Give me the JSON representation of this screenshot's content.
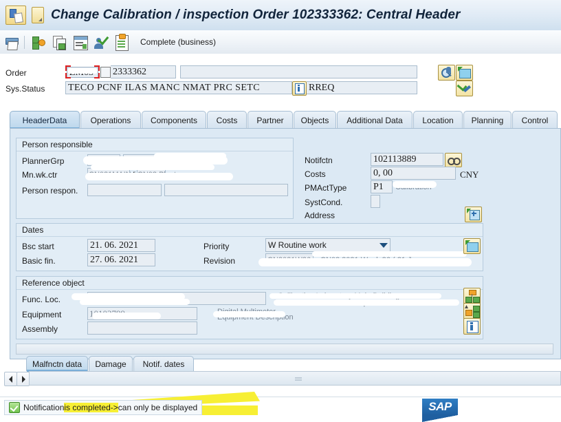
{
  "window": {
    "title": "Change Calibration / inspection Order 102333362: Central Header",
    "sys_icon": "sap-system-icon",
    "menu_icon": "menu-dropdown-icon"
  },
  "toolbar": {
    "buttons": [
      {
        "name": "print-icon",
        "label": ""
      },
      {
        "name": "network-graphic-icon",
        "label": ""
      },
      {
        "name": "copy-icon",
        "label": ""
      },
      {
        "name": "list-display-icon",
        "label": ""
      },
      {
        "name": "check-person-icon",
        "label": ""
      },
      {
        "name": "clipboard-icon",
        "label": ""
      }
    ],
    "complete_label": "Complete (business)"
  },
  "order_header": {
    "order_label": "Order",
    "order_type": "ZM03",
    "order_number": "2333362",
    "order_description": "",
    "sys_status_label": "Sys.Status",
    "status_codes": "TECO PCNF ILAS MANC NMAT PRC  SETC",
    "status_extra": "RREQ",
    "info_icon": "info-icon",
    "search_icon": "search-order-icon",
    "display_icon": "display-object-icon",
    "edit_icon": "check-edit-icon"
  },
  "tabs": [
    {
      "label": "HeaderData",
      "active": true
    },
    {
      "label": "Operations",
      "active": false
    },
    {
      "label": "Components",
      "active": false
    },
    {
      "label": "Costs",
      "active": false
    },
    {
      "label": "Partner",
      "active": false
    },
    {
      "label": "Objects",
      "active": false
    },
    {
      "label": "Additional Data",
      "active": false
    },
    {
      "label": "Location",
      "active": false
    },
    {
      "label": "Planning",
      "active": false
    },
    {
      "label": "Control",
      "active": false
    }
  ],
  "person_responsible": {
    "title": "Person responsible",
    "planner_grp_label": "PlannerGrp",
    "planner_grp_value": "",
    "mn_wk_ctr_label": "Mn.wk.ctr",
    "mn_wk_ctr_value": "",
    "person_respon_label": "Person respon.",
    "person_respon_value": "",
    "person_respon_value2": ""
  },
  "notification_block": {
    "notifctn_label": "Notifctn",
    "notifctn_value": "102113889",
    "notifctn_icon": "link-notification-icon",
    "costs_label": "Costs",
    "costs_value": "0, 00",
    "costs_currency": "CNY",
    "pmacttype_label": "PMActType",
    "pmacttype_value": "P1",
    "pmacttype_text": "",
    "systcond_label": "SystCond.",
    "systcond_value": "",
    "address_label": "Address",
    "address_icon": "address-detail-icon"
  },
  "dates": {
    "title": "Dates",
    "bsc_start_label": "Bsc start",
    "bsc_start_value": "21. 06. 2021",
    "basic_fin_label": "Basic fin.",
    "basic_fin_value": "27. 06. 2021",
    "priority_label": "Priority",
    "priority_value": "W Routine work",
    "priority_dropdown_icon": "chevron-down-icon",
    "revision_label": "Revision",
    "revision_value": "",
    "revision_text": "",
    "calendar_icon": "calendar-icon"
  },
  "reference_object": {
    "title": "Reference object",
    "func_loc_label": "Func. Loc.",
    "func_loc_value": "",
    "func_loc_text": "",
    "equipment_label": "Equipment",
    "equipment_value": "",
    "equipment_text": "",
    "assembly_label": "Assembly",
    "assembly_value": "",
    "structure_icon": "structure-list-icon",
    "structure_up_icon": "structure-up-icon",
    "info_icon": "info-icon"
  },
  "bottom_tabs": [
    {
      "label": "Malfnctn data",
      "active": true
    },
    {
      "label": "Damage",
      "active": false
    },
    {
      "label": "Notif. dates",
      "active": false
    }
  ],
  "scroll": {
    "left_icon": "arrow-left-icon",
    "right_icon": "arrow-right-icon"
  },
  "status_bar": {
    "ok_icon": "success-check-icon",
    "message_part1": "Notification ",
    "message_highlight1": "is completed",
    "message_part2": " ",
    "message_highlight2": "-> ",
    "message_part3": "can only be displayed",
    "sap_logo": "SAP"
  },
  "colors": {
    "title_text": "#11243b",
    "accent_blue": "#7aaed8",
    "panel_bg": "#e2edf6",
    "field_bg": "#e8eef4",
    "highlight_yellow": "#f7ef34",
    "sap_blue": "#2f7ec4",
    "focus_red": "#e02020",
    "success_green": "#3f8c2a"
  }
}
